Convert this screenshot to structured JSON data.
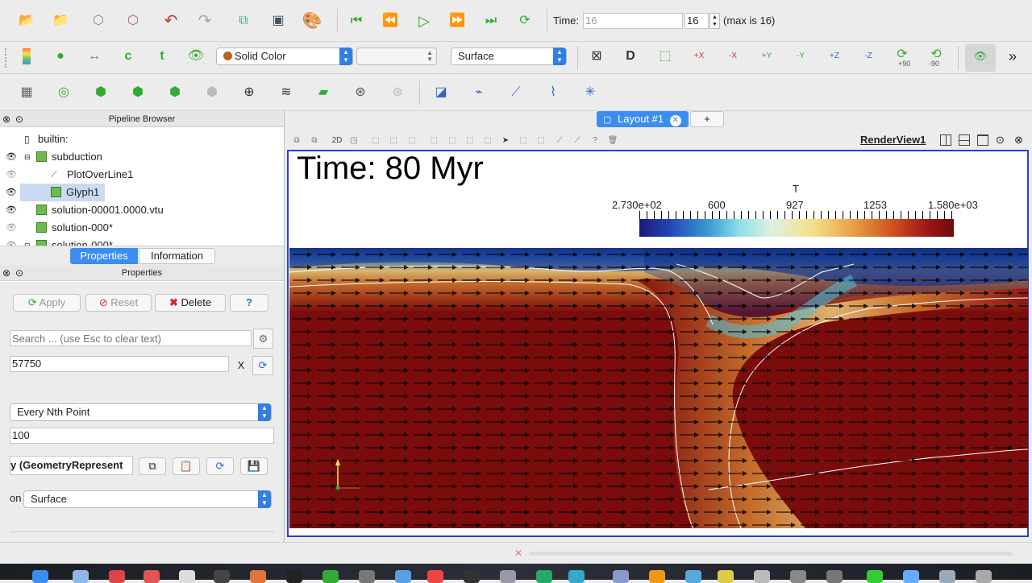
{
  "toolbar1": {
    "time_label": "Time:",
    "time_value": "16",
    "time_spin_value": "16",
    "time_max": "(max is 16)"
  },
  "toolbar2": {
    "color_by": "Solid Color",
    "component": "",
    "representation": "Surface",
    "rot_pos_90": "+90",
    "rot_neg_90": "-90",
    "axes": [
      "+X",
      "-X",
      "+Y",
      "-Y",
      "+Z",
      "-Z"
    ]
  },
  "pipeline": {
    "header": "Pipeline Browser",
    "items": [
      {
        "label": "builtin:"
      },
      {
        "label": "subduction"
      },
      {
        "label": "PlotOverLine1"
      },
      {
        "label": "Glyph1"
      },
      {
        "label": "solution-00001.0000.vtu"
      },
      {
        "label": "solution-000*"
      },
      {
        "label": "solution-000*"
      }
    ]
  },
  "tabs": {
    "properties": "Properties",
    "information": "Information"
  },
  "properties": {
    "header": "Properties",
    "apply": "Apply",
    "reset": "Reset",
    "delete": "Delete",
    "help": "?",
    "search_placeholder": "Search ... (use Esc to clear text)",
    "seed_value": "57750",
    "seed_clear": "X",
    "glyph_mode": "Every Nth Point",
    "stride_value": "100",
    "section_label": "y (GeometryRepresent",
    "repr_label": "on",
    "repr_value": "Surface"
  },
  "layout": {
    "tab_label": "Layout #1",
    "add_tab": "+",
    "view_label": "RenderView1",
    "mode_2d": "2D"
  },
  "render": {
    "time_text": "Time: 80 Myr",
    "colorbar_title": "T",
    "colorbar_ticks": [
      "2.730e+02",
      "600",
      "927",
      "1253",
      "1.580e+03"
    ],
    "colors": {
      "hot": "#7a0a0a",
      "cold": "#0a1a8c",
      "warm": "#d9a64a",
      "cyan": "#4fc3e0"
    }
  }
}
